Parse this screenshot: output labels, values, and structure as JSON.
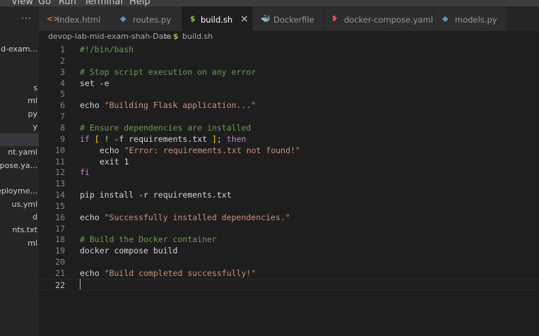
{
  "menubar": [
    "l",
    "View",
    "Go",
    "Run",
    "Terminal",
    "Help"
  ],
  "sidebar": {
    "more_glyph": "···",
    "folder_label": "mid-exam...",
    "files": [
      "s",
      "ml",
      "py",
      "y",
      "",
      "nt.yaml",
      "mpose.ya...",
      "",
      "eployme...",
      "us.yml",
      "d",
      "nts.txt",
      "ml"
    ],
    "selected_index": 4
  },
  "tabs": [
    {
      "label": "index.html",
      "icon": "<>",
      "icon_color": "#e37933",
      "active": false
    },
    {
      "label": "routes.py",
      "icon": "◆",
      "icon_color": "#519aba",
      "active": false
    },
    {
      "label": "build.sh",
      "icon": "$",
      "icon_color": "#8dc149",
      "active": true,
      "close": "×"
    },
    {
      "label": "Dockerfile",
      "icon": "🐳",
      "icon_color": "#1d91e6",
      "active": false
    },
    {
      "label": "docker-compose.yaml",
      "icon": "❥",
      "icon_color": "#e84a5f",
      "active": false
    },
    {
      "label": "models.py",
      "icon": "◆",
      "icon_color": "#519aba",
      "active": false
    }
  ],
  "breadcrumb": {
    "folder": "devop-lab-mid-exam-shah-Data",
    "separator": ">",
    "file_icon": "$",
    "file": "build.sh"
  },
  "editor": {
    "line_numbers": [
      "1",
      "2",
      "3",
      "4",
      "5",
      "6",
      "7",
      "8",
      "9",
      "10",
      "11",
      "12",
      "13",
      "14",
      "15",
      "16",
      "17",
      "18",
      "19",
      "20",
      "21",
      "22"
    ],
    "current_line": 22,
    "lines": [
      [
        {
          "t": "#!/bin/bash",
          "c": "cmt"
        }
      ],
      [],
      [
        {
          "t": "# Stop script execution on any error",
          "c": "cmt"
        }
      ],
      [
        {
          "t": "set -e",
          "c": ""
        }
      ],
      [],
      [
        {
          "t": "echo ",
          "c": ""
        },
        {
          "t": "\"Building Flask application...\"",
          "c": "str"
        }
      ],
      [],
      [
        {
          "t": "# Ensure dependencies are installed",
          "c": "cmt"
        }
      ],
      [
        {
          "t": "if ",
          "c": "kw"
        },
        {
          "t": "[",
          "c": "br"
        },
        {
          "t": " ! -f requirements.txt ",
          "c": ""
        },
        {
          "t": "]",
          "c": "br"
        },
        {
          "t": "; ",
          "c": ""
        },
        {
          "t": "then",
          "c": "kw"
        }
      ],
      [
        {
          "t": "echo ",
          "c": "indent"
        },
        {
          "t": "\"Error: requirements.txt not found!\"",
          "c": "str"
        }
      ],
      [
        {
          "t": "exit 1",
          "c": "indent"
        }
      ],
      [
        {
          "t": "fi",
          "c": "kw"
        }
      ],
      [],
      [
        {
          "t": "pip install -r requirements.txt",
          "c": ""
        }
      ],
      [],
      [
        {
          "t": "echo ",
          "c": ""
        },
        {
          "t": "\"Successfully installed dependencies.\"",
          "c": "str"
        }
      ],
      [],
      [
        {
          "t": "# Build the Docker container",
          "c": "cmt"
        }
      ],
      [
        {
          "t": "docker compose build",
          "c": ""
        }
      ],
      [],
      [
        {
          "t": "echo ",
          "c": ""
        },
        {
          "t": "\"Build completed successfully!\"",
          "c": "str"
        }
      ],
      []
    ]
  }
}
